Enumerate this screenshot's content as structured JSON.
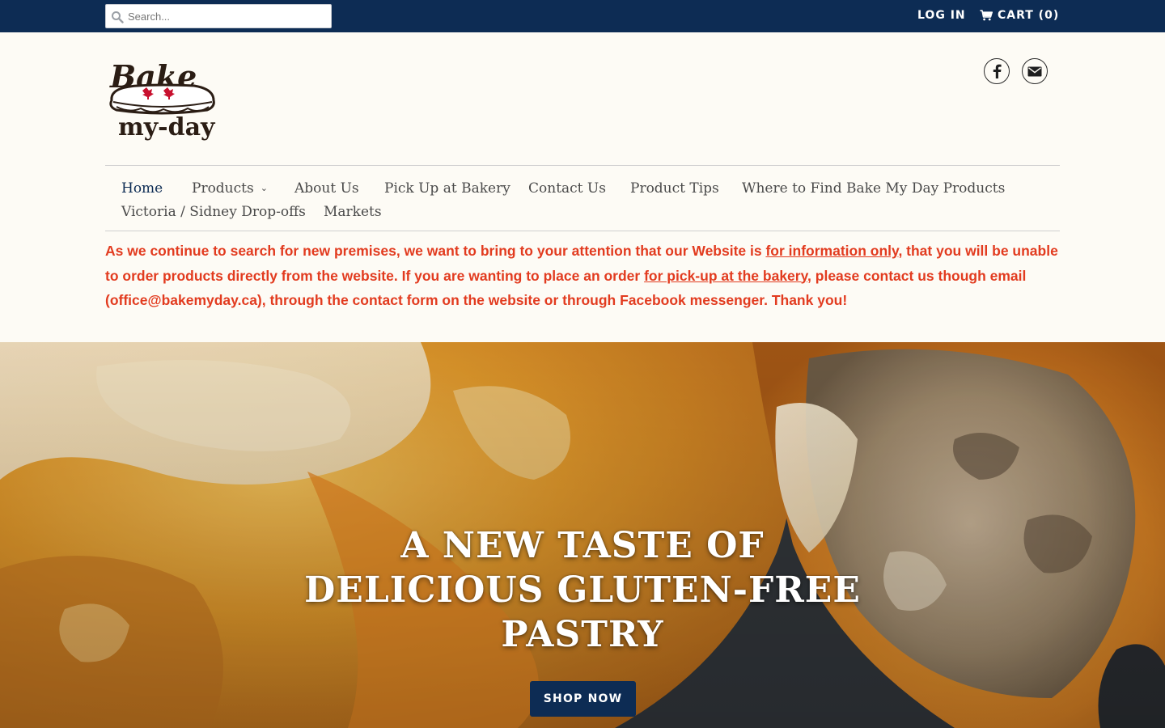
{
  "topbar": {
    "search_placeholder": "Search...",
    "login_label": "LOG IN",
    "cart_label": "CART (0)",
    "background_color": "#0d2c54"
  },
  "header": {
    "logo_text_top": "Bake",
    "logo_text_bottom": "my-day",
    "social_icons": [
      "facebook-icon",
      "mail-icon"
    ]
  },
  "nav": {
    "items": [
      {
        "label": "Home",
        "active": true
      },
      {
        "label": "Products",
        "has_dropdown": true
      },
      {
        "label": "About Us"
      },
      {
        "label": "Pick Up at Bakery"
      },
      {
        "label": "Contact Us"
      },
      {
        "label": "Product Tips"
      },
      {
        "label": "Where to Find Bake My Day Products"
      },
      {
        "label": "Victoria / Sidney Drop-offs"
      },
      {
        "label": "Markets"
      }
    ]
  },
  "notice": {
    "part1": "As we continue to search for new premises, we want to bring to your attention that our Website is ",
    "link1": "for information only",
    "part2": ", that you will be unable to order products directly from the website. If you are wanting to place an order ",
    "link2": "for pick-up at the bakery",
    "part3": ", please contact us though email (office@bakemyday.ca), through the contact form on the website or through Facebook messenger. Thank you!",
    "color": "#e23b1f"
  },
  "hero": {
    "title": "A NEW TASTE OF DELICIOUS GLUTEN-FREE PASTRY",
    "button_label": "SHOP NOW",
    "button_color": "#0d2c54"
  }
}
